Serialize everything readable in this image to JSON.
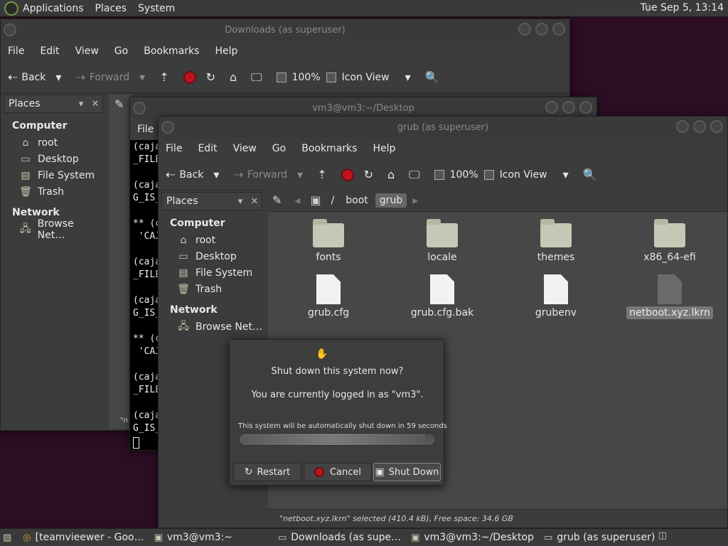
{
  "top_panel": {
    "menus": [
      "Applications",
      "Places",
      "System"
    ],
    "clock": "Tue Sep  5, 13:14"
  },
  "downloads_window": {
    "title": "Downloads (as superuser)",
    "menus": [
      "File",
      "Edit",
      "View",
      "Go",
      "Bookmarks",
      "Help"
    ],
    "toolbar": {
      "back": "Back",
      "forward": "Forward",
      "zoom": "100%",
      "view": "Icon View"
    },
    "sidebar": {
      "header": "Places",
      "computer_label": "Computer",
      "items": [
        "root",
        "Desktop",
        "File System",
        "Trash"
      ],
      "network_label": "Network",
      "network_items": [
        "Browse Net…"
      ]
    },
    "status_fragment": "\"n"
  },
  "terminal_window": {
    "title": "vm3@vm3:~/Desktop",
    "menu_fragment": "File",
    "lines": [
      "(caja",
      "_FILE",
      "",
      "(caja",
      "G_IS_",
      "",
      "** (c",
      " 'CAJ",
      "",
      "(caja",
      "_FILE",
      "",
      "(caja",
      "G_IS_",
      "",
      "** (c",
      " 'CAJ",
      "",
      "(caja",
      "_FILE",
      "",
      "(caja",
      "G_IS_"
    ]
  },
  "grub_window": {
    "title": "grub (as superuser)",
    "menus": [
      "File",
      "Edit",
      "View",
      "Go",
      "Bookmarks",
      "Help"
    ],
    "toolbar": {
      "back": "Back",
      "forward": "Forward",
      "zoom": "100%",
      "view": "Icon View"
    },
    "sidebar": {
      "header": "Places",
      "computer_label": "Computer",
      "items": [
        "root",
        "Desktop",
        "File System",
        "Trash"
      ],
      "network_label": "Network",
      "network_items": [
        "Browse Net…"
      ]
    },
    "path": {
      "sep": "/",
      "crumbs": [
        "boot",
        "grub"
      ]
    },
    "files": [
      "fonts",
      "locale",
      "themes",
      "x86_64-efi",
      "grub.cfg",
      "grub.cfg.bak",
      "grubenv",
      "netboot.xyz.lkrn"
    ],
    "status": "\"netboot.xyz.lkrn\" selected (410.4 kB), Free space: 34.6 GB"
  },
  "shutdown_dialog": {
    "question": "Shut down this system now?",
    "logged_in": "You are currently logged in as \"vm3\".",
    "countdown": "This system will be automatically shut down in 59 seconds",
    "progress": 0.95,
    "buttons": {
      "restart": "Restart",
      "cancel": "Cancel",
      "shutdown": "Shut Down"
    }
  },
  "taskbar": {
    "items": [
      "[teamvieewer - Goo…",
      "vm3@vm3:~",
      "Downloads (as supe…",
      "vm3@vm3:~/Desktop",
      "grub (as superuser)"
    ]
  },
  "colors": {
    "accent_red": "#c0141c",
    "desktop": "#2c0d24"
  }
}
